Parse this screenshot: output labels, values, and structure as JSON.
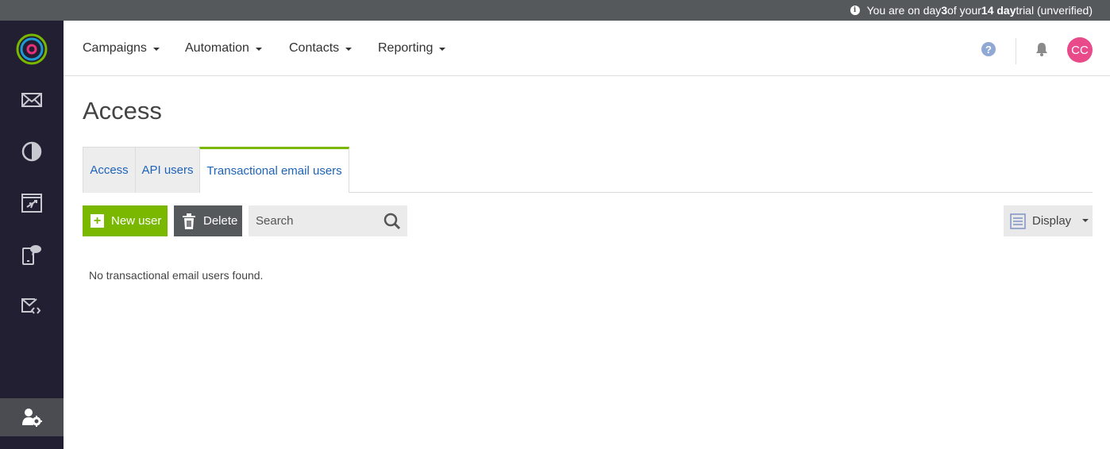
{
  "trial_bar": {
    "prefix": "You are on day ",
    "day": "3",
    "middle": " of your ",
    "length": "14 day",
    "suffix": " trial (unverified)",
    "info_icon": "info-icon"
  },
  "sidebar": {
    "logo": "logo",
    "items": [
      {
        "name": "email-icon",
        "active": false
      },
      {
        "name": "pie-chart-icon",
        "active": false
      },
      {
        "name": "landing-page-icon",
        "active": false
      },
      {
        "name": "sms-icon",
        "active": false
      },
      {
        "name": "transactional-email-icon",
        "active": false
      },
      {
        "name": "user-settings-icon",
        "active": true
      }
    ]
  },
  "nav": {
    "items": [
      {
        "label": "Campaigns"
      },
      {
        "label": "Automation"
      },
      {
        "label": "Contacts"
      },
      {
        "label": "Reporting"
      }
    ],
    "help_glyph": "?",
    "avatar_initials": "CC"
  },
  "page": {
    "title": "Access",
    "tabs": [
      {
        "label": "Access",
        "active": false
      },
      {
        "label": "API users",
        "active": false
      },
      {
        "label": "Transactional email users",
        "active": true
      }
    ],
    "toolbar": {
      "new_user_label": "New user",
      "delete_label": "Delete",
      "search_placeholder": "Search",
      "display_label": "Display"
    },
    "empty_message": "No transactional email users found."
  },
  "colors": {
    "accent_green": "#7ab800",
    "sidebar_bg": "#221f33",
    "link_blue": "#1e63b8",
    "avatar_pink": "#e84a8a"
  }
}
